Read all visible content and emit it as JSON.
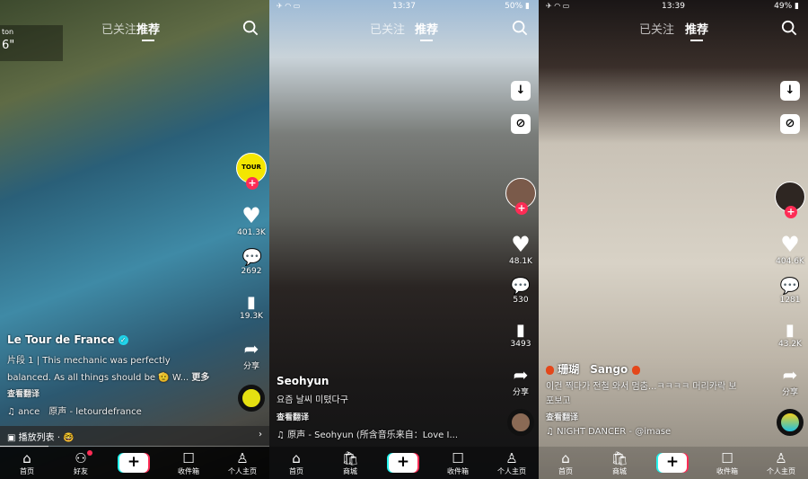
{
  "top_tabs": {
    "following": "已关注",
    "recommended": "推荐",
    "active": "recommended"
  },
  "nav_labels": {
    "home": "首页",
    "friends": "好友",
    "mall": "商城",
    "inbox": "收件箱",
    "profile": "个人主页",
    "share": "分享"
  },
  "panels": [
    {
      "overlay": {
        "line1": "ton",
        "line2": "6\""
      },
      "likes": "401.3K",
      "comments": "2692",
      "favorites": "19.3K",
      "author": "Le Tour de France",
      "verified": true,
      "caption_line1": "片段 1 | This mechanic was perfectly",
      "caption_line2": "balanced. As all things should be 🫡 W...",
      "more": "更多",
      "translate": "查看翻译",
      "music": "ance　原声 - letourdefrance",
      "playlist": "播放列表 · 🤓",
      "progress": 0.18,
      "friends_badge": true
    },
    {
      "status": {
        "time": "13:37",
        "battery": "50%"
      },
      "likes": "48.1K",
      "comments": "530",
      "favorites": "3493",
      "author": "Seohyun",
      "caption_line1": "요즘 날씨 미텼다구",
      "translate": "查看翻译",
      "music": "原声 - Seohyun (所含音乐来自：Love I..."
    },
    {
      "status": {
        "time": "13:39",
        "battery": "49%"
      },
      "likes": "404.6K",
      "comments": "1281",
      "favorites": "43.2K",
      "author": "珊瑚　Sango",
      "caption_line1": "이건 찍다가 전철 와서 멈춤...ㅋㅋㅋㅋ 머리카락 보",
      "caption_line2": "포보고",
      "translate": "查看翻译",
      "music": "NIGHT DANCER - @imase"
    }
  ],
  "colors": {
    "accent_red": "#fe2c55",
    "accent_cyan": "#25f4ee",
    "verified": "#20d5ec"
  }
}
